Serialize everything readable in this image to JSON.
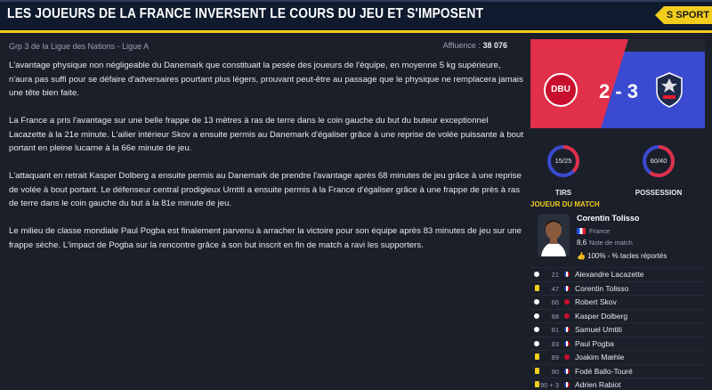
{
  "header": {
    "title": "Les joueurs de la France inversent le cours du jeu et s'imposent",
    "section_tag": "S SPORT"
  },
  "meta": {
    "competition": "Grp 3 de la Ligue des Nations - Ligue A",
    "attendance_label": "Affluence :",
    "attendance_value": "38 076"
  },
  "article": {
    "p1": "L'avantage physique non négligeable du Danemark que constituait la pesée des joueurs de l'équipe, en moyenne 5 kg supérieure, n'aura pas suffi pour se défaire d'adversaires pourtant plus légers, prouvant peut-être au passage que le physique ne remplacera jamais une tête bien faite.",
    "p2": "La France a pris l'avantage sur une belle frappe de 13 mètres à ras de terre dans le coin gauche du but du buteur exceptionnel Lacazette à la 21e minute. L'ailier intérieur Skov a ensuite permis au Danemark d'égaliser grâce à une reprise de volée puissante à bout portant en pleine lucarne à la 66e minute de jeu.",
    "p3": "L'attaquant en retrait Kasper Dolberg a ensuite permis au Danemark de prendre l'avantage après 68 minutes de jeu grâce à une reprise de volée à bout portant. Le défenseur central prodigieux Umtiti a ensuite permis à la France d'égaliser grâce à une frappe de près à ras de terre dans le coin gauche du but à la 81e minute de jeu.",
    "p4": "Le milieu de classe mondiale Paul Pogba est finalement parvenu à arracher la victoire pour son équipe après 83 minutes de jeu sur une frappe sèche. L'impact de Pogba sur la rencontre grâce à son but inscrit en fin de match a ravi les supporters."
  },
  "scorecard": {
    "home_crest_text": "DBU",
    "score": "2 - 3",
    "home_color": "#e0304a",
    "away_color": "#3a4ad1"
  },
  "stats": {
    "shots": {
      "label": "TIRS",
      "value": "15/25",
      "home": 15,
      "away": 25
    },
    "possession": {
      "label": "POSSESSION",
      "value": "60/40",
      "home": 60,
      "away": 40
    }
  },
  "potm": {
    "title": "JOUEUR DU MATCH",
    "name": "Corentin Tolisso",
    "country": "France",
    "rating": "8,6",
    "rating_label": "Note de match",
    "stat": "100% - % tacles réportés"
  },
  "events": [
    {
      "type": "goal",
      "minute": "21",
      "team": "fr",
      "player": "Alexandre Lacazette"
    },
    {
      "type": "yellow",
      "minute": "47",
      "team": "fr",
      "player": "Corentin Tolisso"
    },
    {
      "type": "goal",
      "minute": "66",
      "team": "dk",
      "player": "Robert Skov"
    },
    {
      "type": "goal",
      "minute": "68",
      "team": "dk",
      "player": "Kasper Dolberg"
    },
    {
      "type": "goal",
      "minute": "81",
      "team": "fr",
      "player": "Samuel Umtiti"
    },
    {
      "type": "goal",
      "minute": "83",
      "team": "fr",
      "player": "Paul Pogba"
    },
    {
      "type": "yellow",
      "minute": "89",
      "team": "dk",
      "player": "Joakim Mæhle"
    },
    {
      "type": "yellow",
      "minute": "90",
      "team": "fr",
      "player": "Fodé Ballo-Touré"
    },
    {
      "type": "yellow",
      "minute": "90 + 3",
      "team": "fr",
      "player": "Adrien Rabiot"
    }
  ]
}
